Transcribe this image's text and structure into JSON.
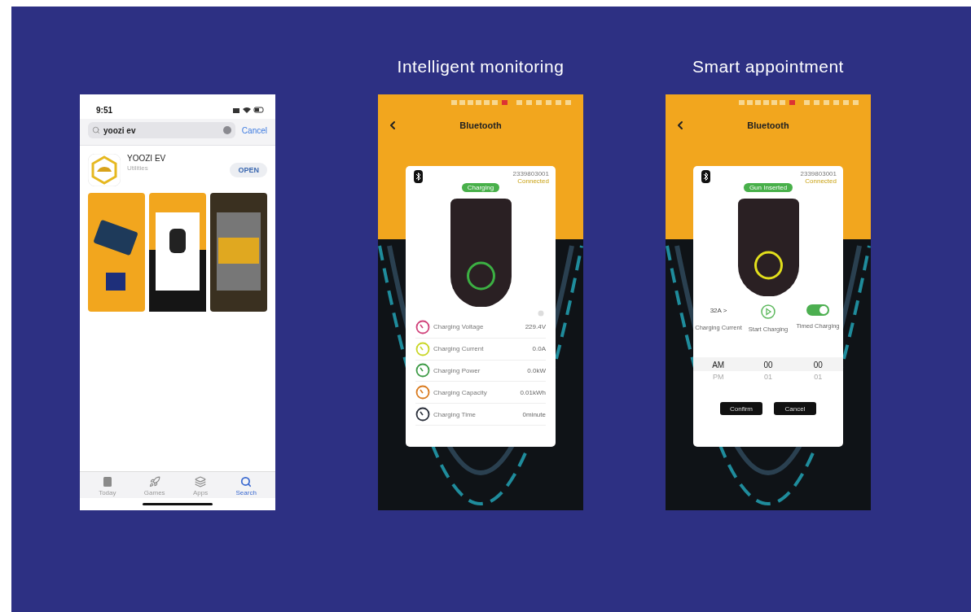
{
  "app_store": {
    "time": "9:51",
    "search": {
      "value": "yoozi ev"
    },
    "cancel": "Cancel",
    "app": {
      "name": "YOOZI EV",
      "category": "Utilities",
      "action": "OPEN"
    },
    "tabs": [
      {
        "kind": "today",
        "label": "Today",
        "selected": false
      },
      {
        "kind": "games",
        "label": "Games",
        "selected": false
      },
      {
        "kind": "apps",
        "label": "Apps",
        "selected": false
      },
      {
        "kind": "search",
        "label": "Search",
        "selected": true
      }
    ]
  },
  "screens": [
    {
      "kind": "monitoring",
      "caption": "Intelligent monitoring",
      "title": "Bluetooth",
      "serial": "2339803001",
      "connection": "Connected",
      "status": "Charging",
      "color": "#3cb043",
      "readings": [
        {
          "label": "Charging Voltage",
          "value": "229.4V",
          "color": "#d0427a"
        },
        {
          "label": "Charging Current",
          "value": "0.0A",
          "color": "#c9d626"
        },
        {
          "label": "Charging Power",
          "value": "0.0kW",
          "color": "#3c9a45"
        },
        {
          "label": "Charging Capacity",
          "value": "0.01kWh",
          "color": "#d97a1e"
        },
        {
          "label": "Charging Time",
          "value": "0minute",
          "color": "#2a2f3a"
        }
      ]
    },
    {
      "kind": "appointment",
      "caption": "Smart appointment",
      "title": "Bluetooth",
      "serial": "2339803001",
      "connection": "Connected",
      "status": "Gun Inserted",
      "color": "#e2df1c",
      "controls": [
        {
          "kind": "current",
          "value": "32A >",
          "label": "Charging Current"
        },
        {
          "kind": "play",
          "label": "Start Charging"
        },
        {
          "kind": "toggle",
          "on": true,
          "label": "Timed Charging"
        }
      ],
      "picker": [
        {
          "options": [
            {
              "text": "AM",
              "selected": true
            },
            {
              "text": "PM",
              "selected": false
            }
          ]
        },
        {
          "options": [
            {
              "text": "00",
              "selected": true
            },
            {
              "text": "01",
              "selected": false
            }
          ]
        },
        {
          "options": [
            {
              "text": "00",
              "selected": true
            },
            {
              "text": "01",
              "selected": false
            }
          ]
        }
      ],
      "buttons": [
        "Confirm",
        "Cancel"
      ]
    }
  ]
}
